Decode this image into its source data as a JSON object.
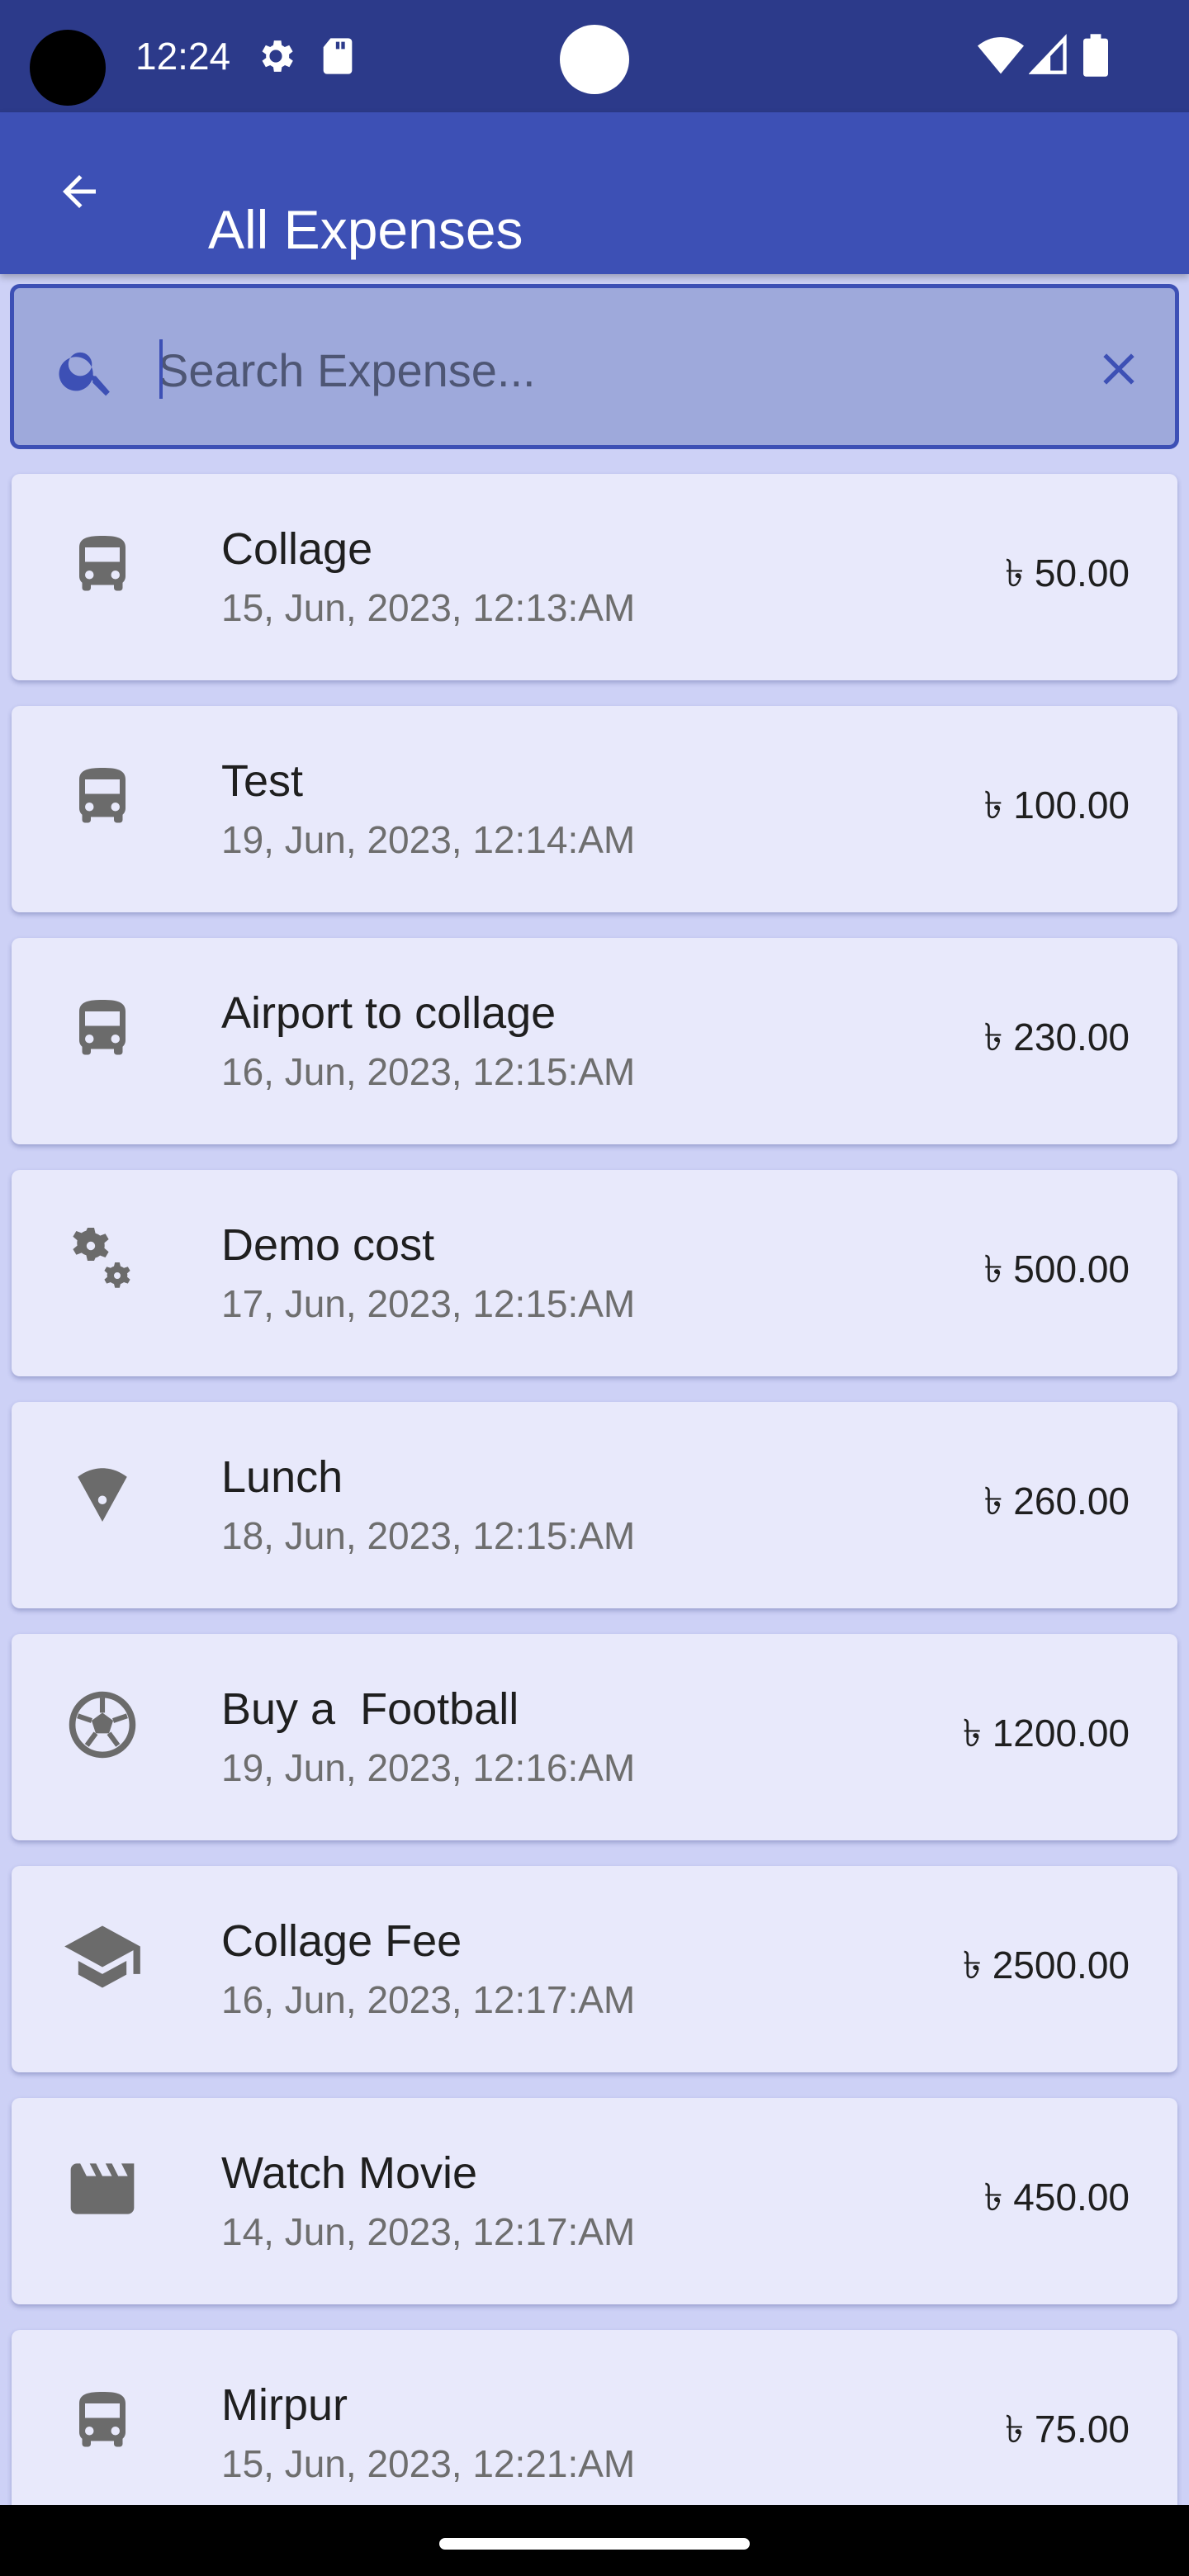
{
  "status_bar": {
    "time": "12:24",
    "icons": [
      "settings-icon",
      "sd-card-icon",
      "wifi-icon",
      "signal-icon",
      "battery-icon"
    ]
  },
  "app_bar": {
    "title": "All Expenses",
    "back_icon": "arrow-back-icon",
    "color": "#3d50b5"
  },
  "search": {
    "placeholder": "Search Expense...",
    "value": "",
    "search_icon": "search-icon",
    "clear_icon": "close-icon"
  },
  "expenses": [
    {
      "title": "Collage",
      "date": "15, Jun, 2023, 12:13:AM",
      "amount": "৳ 50.00",
      "icon": "bus-icon"
    },
    {
      "title": "Test",
      "date": "19, Jun, 2023, 12:14:AM",
      "amount": "৳ 100.00",
      "icon": "bus-icon"
    },
    {
      "title": "Airport to collage",
      "date": "16, Jun, 2023, 12:15:AM",
      "amount": "৳ 230.00",
      "icon": "bus-icon"
    },
    {
      "title": "Demo cost",
      "date": "17, Jun, 2023, 12:15:AM",
      "amount": "৳ 500.00",
      "icon": "gears-icon"
    },
    {
      "title": "Lunch",
      "date": "18, Jun, 2023, 12:15:AM",
      "amount": "৳ 260.00",
      "icon": "pizza-icon"
    },
    {
      "title": "Buy a  Football",
      "date": "19, Jun, 2023, 12:16:AM",
      "amount": "৳ 1200.00",
      "icon": "football-icon"
    },
    {
      "title": "Collage Fee",
      "date": "16, Jun, 2023, 12:17:AM",
      "amount": "৳ 2500.00",
      "icon": "graduation-cap-icon"
    },
    {
      "title": "Watch Movie",
      "date": "14, Jun, 2023, 12:17:AM",
      "amount": "৳ 450.00",
      "icon": "clapperboard-icon"
    },
    {
      "title": "Mirpur",
      "date": "15, Jun, 2023, 12:21:AM",
      "amount": "৳ 75.00",
      "icon": "bus-icon"
    }
  ]
}
